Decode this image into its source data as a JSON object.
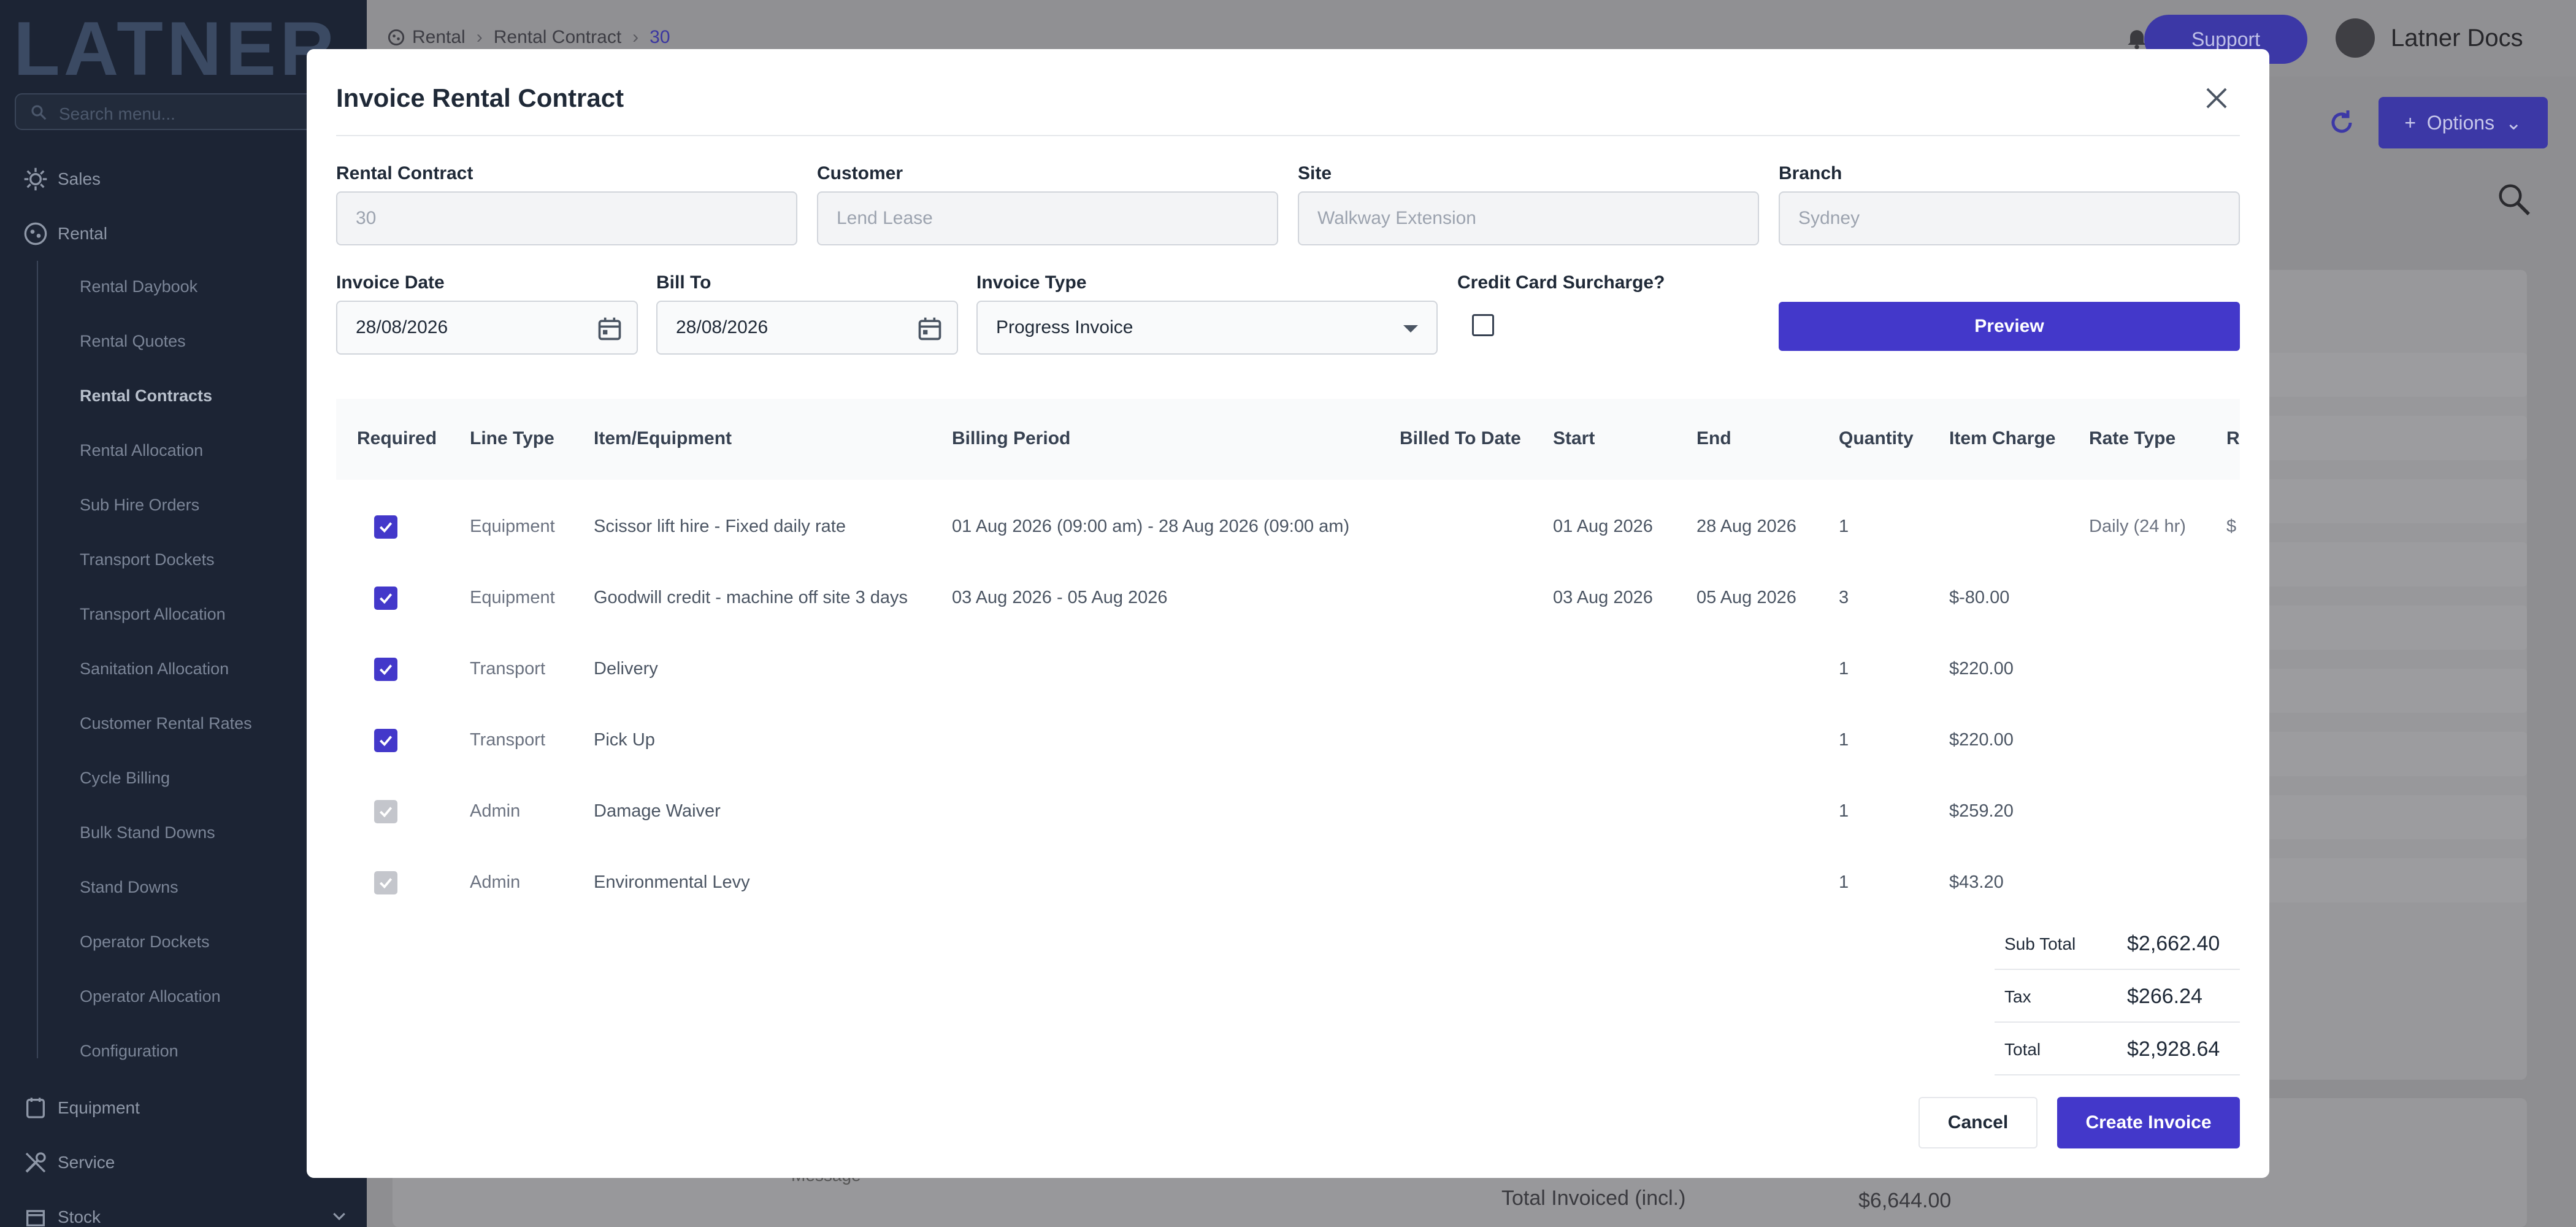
{
  "app": {
    "logo": "LATNER",
    "search_placeholder": "Search menu...",
    "sidebar": {
      "top_items": [
        {
          "label": "Sales",
          "icon": "sales-icon"
        },
        {
          "label": "Rental",
          "icon": "rental-icon"
        }
      ],
      "rental_subitems": [
        "Rental Daybook",
        "Rental Quotes",
        "Rental Contracts",
        "Rental Allocation",
        "Sub Hire Orders",
        "Transport Dockets",
        "Transport Allocation",
        "Sanitation Allocation",
        "Customer Rental Rates",
        "Cycle Billing",
        "Bulk Stand Downs",
        "Stand Downs",
        "Operator Dockets",
        "Operator Allocation",
        "Configuration"
      ],
      "bottom_items": [
        {
          "label": "Equipment",
          "icon": "equipment-icon"
        },
        {
          "label": "Service",
          "icon": "service-icon"
        },
        {
          "label": "Stock",
          "icon": "stock-icon"
        }
      ]
    },
    "breadcrumb": [
      "Rental",
      "Rental Contract",
      "30"
    ],
    "support_label": "Support",
    "user_name": "Latner Docs",
    "options_label": "Options",
    "background_text": {
      "message_placeholder": "Message",
      "total_invoiced_label": "Total Invoiced (incl.)",
      "total_invoiced_value": "$6,644.00"
    }
  },
  "modal": {
    "title": "Invoice Rental Contract",
    "fields": {
      "rental_contract": {
        "label": "Rental Contract",
        "value": "30"
      },
      "customer": {
        "label": "Customer",
        "value": "Lend Lease"
      },
      "site": {
        "label": "Site",
        "value": "Walkway Extension"
      },
      "branch": {
        "label": "Branch",
        "value": "Sydney"
      },
      "invoice_date": {
        "label": "Invoice Date",
        "value": "28/08/2026"
      },
      "bill_to": {
        "label": "Bill To",
        "value": "28/08/2026"
      },
      "invoice_type": {
        "label": "Invoice Type",
        "value": "Progress Invoice"
      },
      "credit_card_surcharge": {
        "label": "Credit Card Surcharge?",
        "checked": false
      }
    },
    "preview_label": "Preview",
    "table": {
      "columns": [
        "Required",
        "Line Type",
        "Item/Equipment",
        "Billing Period",
        "Billed To Date",
        "Start",
        "End",
        "Quantity",
        "Item Charge",
        "Rate Type",
        "R"
      ],
      "rows": [
        {
          "required": "checked",
          "line_type": "Equipment",
          "item": "Scissor lift hire - Fixed daily rate",
          "billing_period": "01 Aug 2026 (09:00 am) - 28 Aug 2026 (09:00 am)",
          "billed_to_date": "",
          "start": "01 Aug 2026",
          "end": "28 Aug 2026",
          "quantity": "1",
          "item_charge": "",
          "rate_type": "Daily (24 hr)",
          "extra": "$"
        },
        {
          "required": "checked",
          "line_type": "Equipment",
          "item": "Goodwill credit - machine off site 3 days",
          "billing_period": "03 Aug 2026 - 05 Aug 2026",
          "billed_to_date": "",
          "start": "03 Aug 2026",
          "end": "05 Aug 2026",
          "quantity": "3",
          "item_charge": "$-80.00",
          "rate_type": "",
          "extra": ""
        },
        {
          "required": "checked",
          "line_type": "Transport",
          "item": "Delivery",
          "billing_period": "",
          "billed_to_date": "",
          "start": "",
          "end": "",
          "quantity": "1",
          "item_charge": "$220.00",
          "rate_type": "",
          "extra": ""
        },
        {
          "required": "checked",
          "line_type": "Transport",
          "item": "Pick Up",
          "billing_period": "",
          "billed_to_date": "",
          "start": "",
          "end": "",
          "quantity": "1",
          "item_charge": "$220.00",
          "rate_type": "",
          "extra": ""
        },
        {
          "required": "disabled",
          "line_type": "Admin",
          "item": "Damage Waiver",
          "billing_period": "",
          "billed_to_date": "",
          "start": "",
          "end": "",
          "quantity": "1",
          "item_charge": "$259.20",
          "rate_type": "",
          "extra": ""
        },
        {
          "required": "disabled",
          "line_type": "Admin",
          "item": "Environmental Levy",
          "billing_period": "",
          "billed_to_date": "",
          "start": "",
          "end": "",
          "quantity": "1",
          "item_charge": "$43.20",
          "rate_type": "",
          "extra": ""
        }
      ]
    },
    "totals": [
      {
        "label": "Sub Total",
        "value": "$2,662.40"
      },
      {
        "label": "Tax",
        "value": "$266.24"
      },
      {
        "label": "Total",
        "value": "$2,928.64"
      }
    ],
    "cancel_label": "Cancel",
    "create_label": "Create Invoice"
  },
  "colors": {
    "primary": "#4338ca",
    "overlay_primary": "#3c38a6",
    "sidebar_bg": "#1c2434"
  }
}
